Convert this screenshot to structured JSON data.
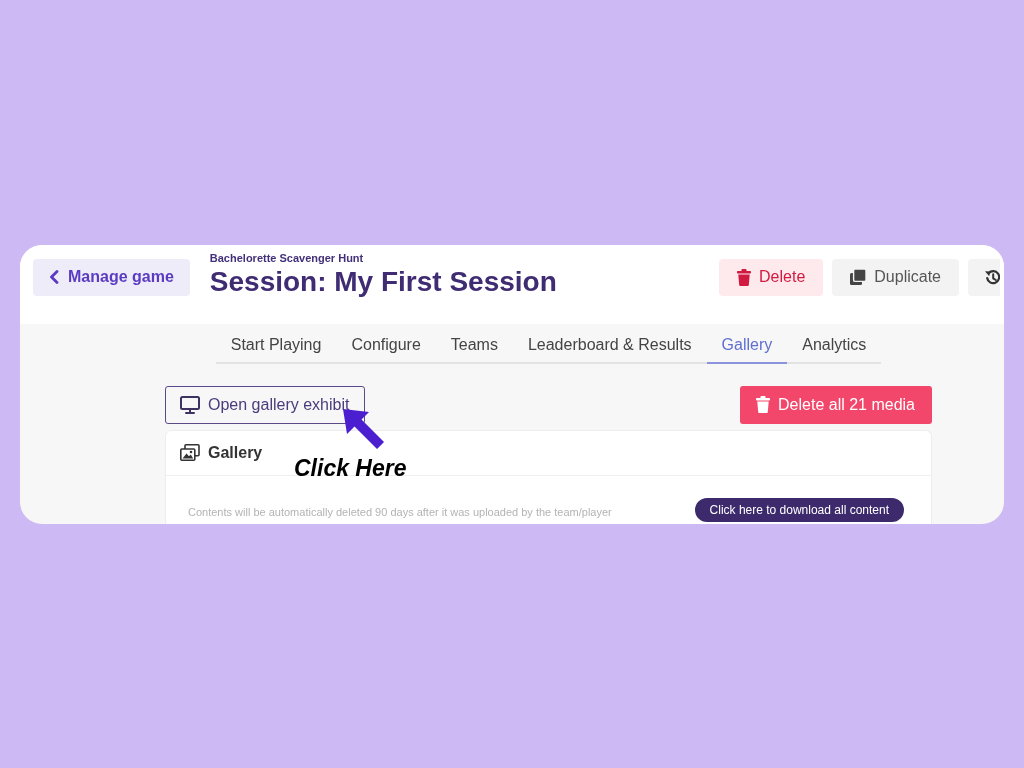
{
  "header": {
    "back_button": {
      "label": "Manage game"
    },
    "game_name": "Bachelorette Scavenger Hunt",
    "title": "Session: My First Session",
    "actions": [
      {
        "kind": "delete",
        "label": "Delete"
      },
      {
        "kind": "duplicate",
        "label": "Duplicate"
      },
      {
        "kind": "history"
      }
    ]
  },
  "tabs": [
    {
      "label": "Start Playing",
      "selected": false
    },
    {
      "label": "Configure",
      "selected": false
    },
    {
      "label": "Teams",
      "selected": false
    },
    {
      "label": "Leaderboard & Results",
      "selected": false
    },
    {
      "label": "Gallery",
      "selected": true
    },
    {
      "label": "Analytics",
      "selected": false
    }
  ],
  "toolbar": {
    "exhibit_button": {
      "label": "Open gallery exhibit"
    },
    "delete_all_button": {
      "label": "Delete all 21 media"
    }
  },
  "gallery_card": {
    "title": "Gallery",
    "notice": "Contents will be automatically deleted 90 days after it was uploaded by the team/player",
    "download_button": {
      "label": "Click here to download all content"
    }
  },
  "annotation": {
    "label": "Click Here"
  }
}
